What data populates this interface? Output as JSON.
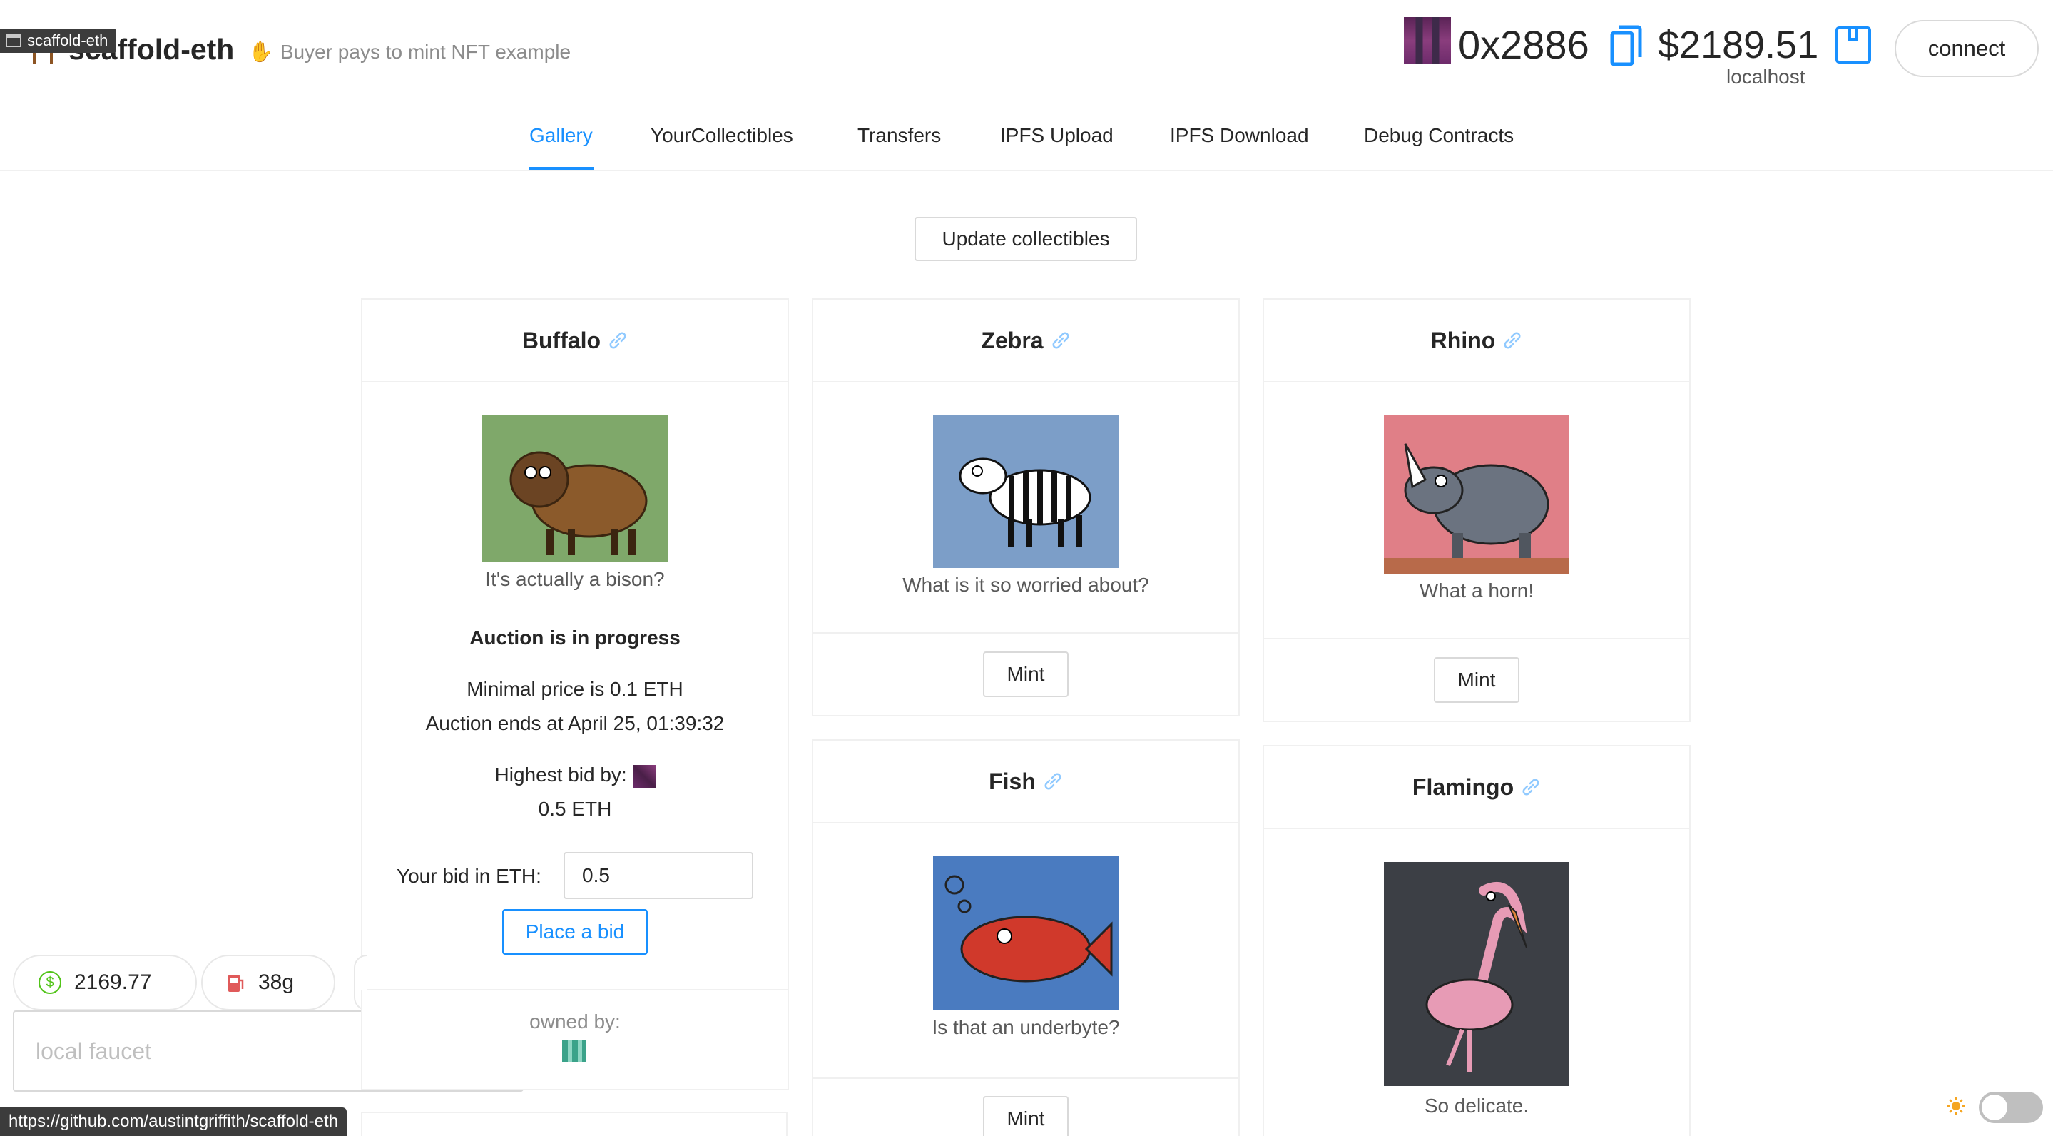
{
  "tooltip": {
    "label": "scaffold-eth"
  },
  "brand": {
    "title": "scaffold-eth",
    "subtitle": "Buyer pays to mint NFT example"
  },
  "account": {
    "address": "0x2886",
    "balance": "$2189.51",
    "network": "localhost",
    "connect_label": "connect"
  },
  "nav": {
    "tabs": [
      {
        "label": "Gallery",
        "active": true
      },
      {
        "label": "YourCollectibles",
        "active": false
      },
      {
        "label": "Transfers",
        "active": false
      },
      {
        "label": "IPFS Upload",
        "active": false
      },
      {
        "label": "IPFS Download",
        "active": false
      },
      {
        "label": "Debug Contracts",
        "active": false
      }
    ]
  },
  "update_button": {
    "label": "Update collectibles"
  },
  "cards": {
    "buffalo": {
      "title": "Buffalo",
      "description": "It's actually a bison?",
      "auction_status": "Auction is in progress",
      "min_price": "Minimal price is 0.1 ETH",
      "ends_at": "Auction ends at April 25, 01:39:32",
      "highest_bid_label": "Highest bid by:",
      "highest_bid_amount": "0.5 ETH",
      "bid_label": "Your bid in ETH:",
      "bid_value": "0.5",
      "place_bid_label": "Place a bid",
      "owned_label": "owned by:"
    },
    "zebra": {
      "title": "Zebra",
      "description": "What is it so worried about?",
      "mint_label": "Mint"
    },
    "rhino": {
      "title": "Rhino",
      "description": "What a horn!",
      "mint_label": "Mint"
    },
    "fish": {
      "title": "Fish",
      "description": "Is that an underbyte?",
      "mint_label": "Mint"
    },
    "flamingo": {
      "title": "Flamingo",
      "description": "So delicate."
    }
  },
  "widgets": {
    "eth_price": "2169.77",
    "gas_price": "38g",
    "faucet_placeholder": "local faucet"
  },
  "status_bar": {
    "url": "https://github.com/austintgriffith/scaffold-eth"
  },
  "colors": {
    "accent": "#1890ff",
    "border": "#f0f0f0",
    "success": "#52c41a"
  }
}
